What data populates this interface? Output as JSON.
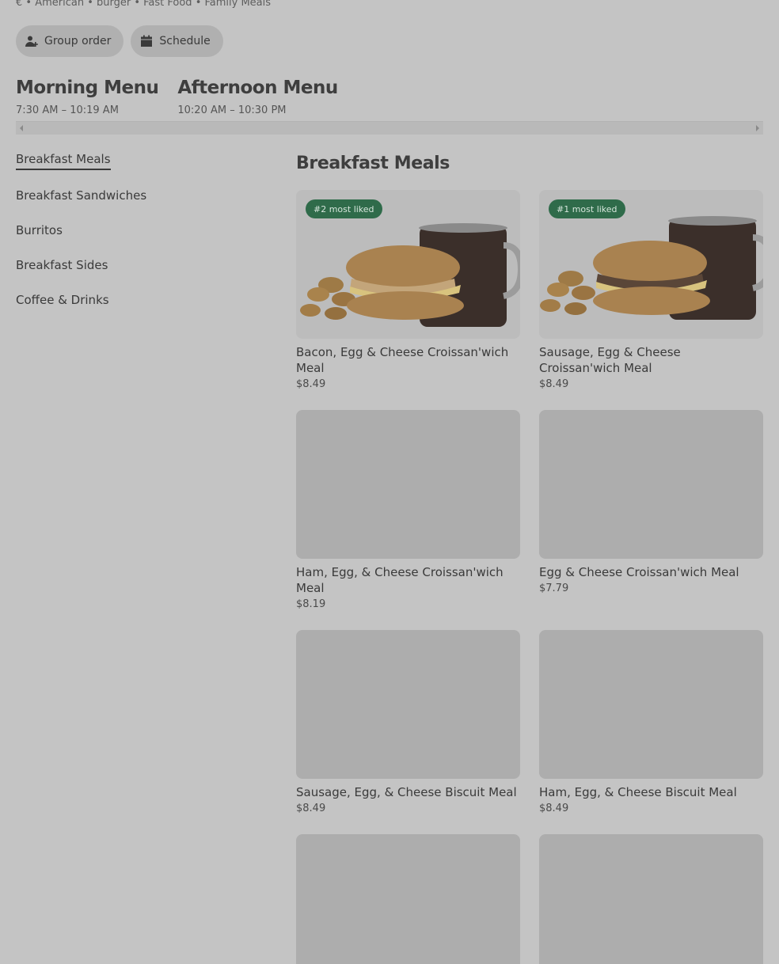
{
  "store": {
    "tags": "€ • American • burger • Fast Food • Family Meals"
  },
  "actions": {
    "group_order": "Group order",
    "schedule": "Schedule"
  },
  "menus": [
    {
      "title": "Morning Menu",
      "hours": "7:30 AM – 10:19 AM"
    },
    {
      "title": "Afternoon Menu",
      "hours": "10:20 AM – 10:30 PM"
    }
  ],
  "sidebar": {
    "items": [
      {
        "label": "Breakfast Meals"
      },
      {
        "label": "Breakfast Sandwiches"
      },
      {
        "label": "Burritos"
      },
      {
        "label": "Breakfast Sides"
      },
      {
        "label": "Coffee & Drinks"
      }
    ]
  },
  "section": {
    "title": "Breakfast Meals",
    "items": [
      {
        "badge": "#2 most liked",
        "name": "Bacon, Egg & Cheese Croissan'wich Meal",
        "price": "$8.49"
      },
      {
        "badge": "#1 most liked",
        "name": "Sausage, Egg & Cheese Croissan'wich Meal",
        "price": "$8.49"
      },
      {
        "name": "Ham, Egg, & Cheese Croissan'wich Meal",
        "price": "$8.19"
      },
      {
        "name": "Egg & Cheese Croissan'wich Meal",
        "price": "$7.79"
      },
      {
        "name": "Sausage, Egg, & Cheese Biscuit Meal",
        "price": "$8.49"
      },
      {
        "name": "Ham, Egg, & Cheese Biscuit Meal",
        "price": "$8.49"
      }
    ]
  },
  "colors": {
    "overlay_bg": "#c4c4c4",
    "badge_bg": "#2f6b4a"
  }
}
